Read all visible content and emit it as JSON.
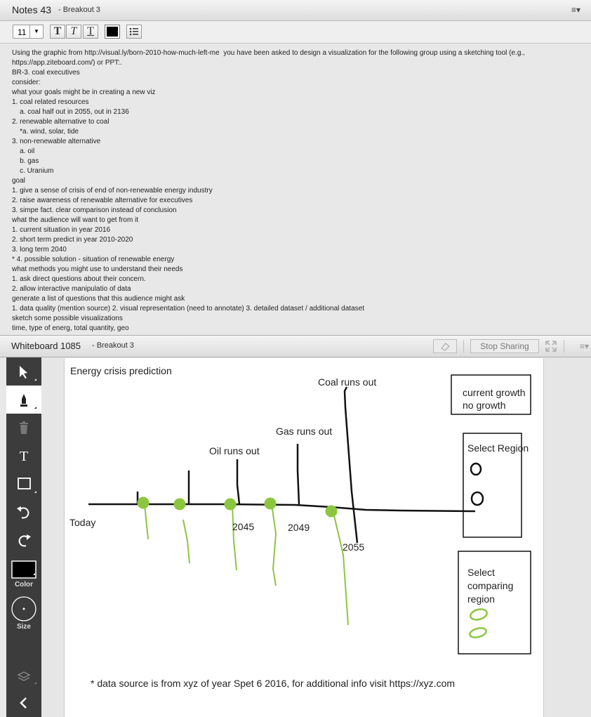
{
  "notes": {
    "title": "Notes 43",
    "subtitle": "- Breakout 3",
    "menu_icon": "list-menu-icon",
    "font_size": "11",
    "text_color": "#000000",
    "lines": [
      "Using the graphic from http://visual.ly/born-2010-how-much-left-me  you have been asked to design a visualization for the following group using a sketching tool (e.g.,",
      "https://app.ziteboard.com/) or PPT:.",
      "BR-3. coal executives",
      "consider:",
      "what your goals might be in creating a new viz",
      "1. coal related resources",
      "    a. coal half out in 2055, out in 2136",
      "2. renewable alternative to coal",
      "    *a. wind, solar, tide",
      "3. non-renewable alternative",
      "    a. oil",
      "    b. gas",
      "    c. Uranium",
      "goal",
      "1. give a sense of crisis of end of non-renewable energy industry",
      "2. raise awareness of renewable alternative for executives",
      "3. simpe fact. clear comparison instead of conclusion",
      "what the audience will want to get from it",
      "1. current situation in year 2016",
      "2. short term predict in year 2010-2020",
      "3. long term 2040",
      "* 4. possible solution - situation of renewable energy",
      "what methods you might use to understand their needs",
      "1. ask direct questions about their concern.",
      "2. allow interactive manipulatio of data",
      "generate a list of questions that this audience might ask",
      "1. data quality (mention source) 2. visual representation (need to annotate) 3. detailed dataset / additional dataset",
      "sketch some possible visualizations",
      "time, type of energ, total quantity, geo"
    ]
  },
  "whiteboard": {
    "title": "Whiteboard 1085",
    "subtitle": "- Breakout 3",
    "stop_sharing_label": "Stop Sharing",
    "tools": {
      "color_label": "Color",
      "size_label": "Size",
      "current_color": "#000000"
    },
    "sketch": {
      "title": "Energy crisis prediction",
      "today_label": "Today",
      "oil_label": "Oil runs out",
      "gas_label": "Gas runs out",
      "coal_label": "Coal runs out",
      "year_2045": "2045",
      "year_2049": "2049",
      "year_2055": "2055",
      "growth_option_1": "current growth",
      "growth_option_2": "no growth",
      "select_region_label": "Select Region",
      "compare_line_1": "Select",
      "compare_line_2": "comparing",
      "compare_line_3": "region",
      "footnote": "* data source is from xyz of year Spet 6 2016, for additional info visit https://xyz.com",
      "accent_green": "#8cc63f"
    }
  }
}
